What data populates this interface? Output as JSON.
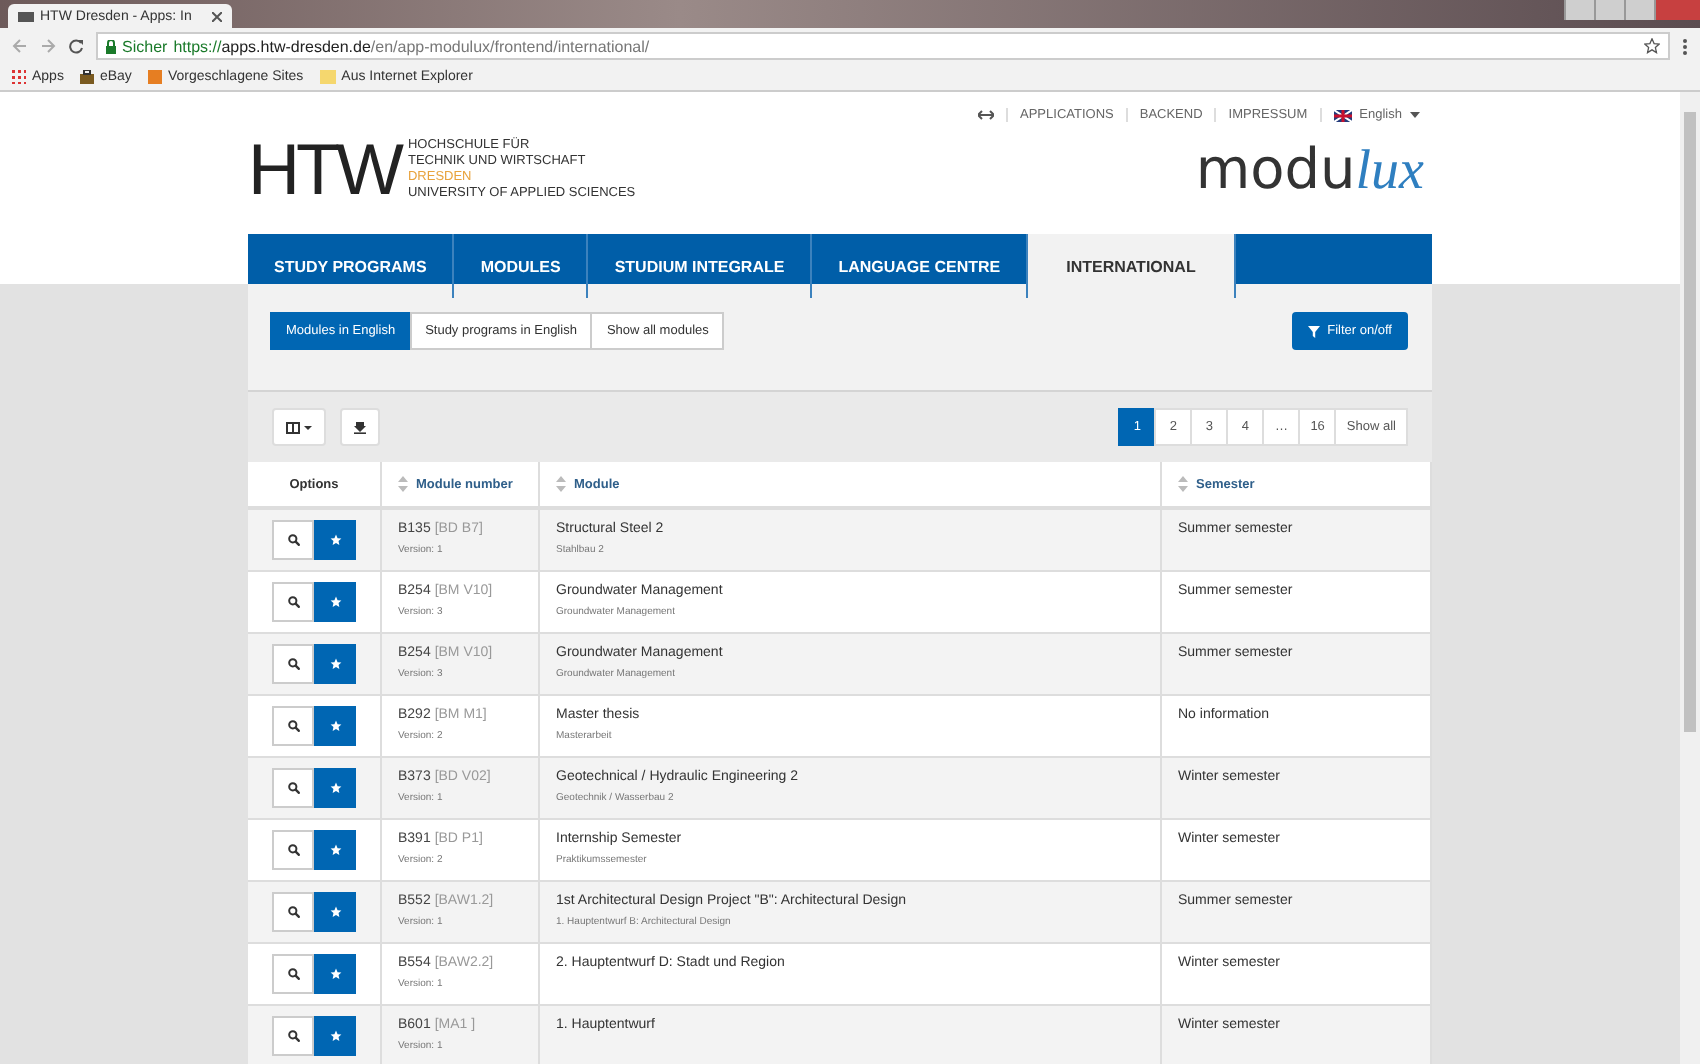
{
  "browser": {
    "tab_title": "HTW Dresden - Apps: In",
    "secure_label": "Sicher",
    "url_scheme": "https://",
    "url_domain": "apps.htw-dresden.de",
    "url_path": "/en/app-modulux/frontend/international/",
    "bookmarks": [
      "Apps",
      "eBay",
      "Vorgeschlagene Sites",
      "Aus Internet Explorer"
    ]
  },
  "top_links": [
    "APPLICATIONS",
    "BACKEND",
    "IMPRESSUM"
  ],
  "language": "English",
  "logo": {
    "mark": "HTW",
    "lines": [
      "HOCHSCHULE FÜR",
      "TECHNIK UND WIRTSCHAFT",
      "DRESDEN",
      "UNIVERSITY OF APPLIED SCIENCES"
    ],
    "app_name": "modu",
    "app_name_script": "lux"
  },
  "nav": [
    {
      "label": "STUDY PROGRAMS",
      "selected": false
    },
    {
      "label": "MODULES",
      "selected": false
    },
    {
      "label": "STUDIUM INTEGRALE",
      "selected": false
    },
    {
      "label": "LANGUAGE CENTRE",
      "selected": false
    },
    {
      "label": "INTERNATIONAL",
      "selected": true
    }
  ],
  "filters": [
    {
      "label": "Modules in English",
      "selected": true
    },
    {
      "label": "Study programs in English",
      "selected": false
    },
    {
      "label": "Show all modules",
      "selected": false
    }
  ],
  "filter_button": "Filter on/off",
  "pagination": [
    {
      "label": "1",
      "selected": true
    },
    {
      "label": "2",
      "selected": false
    },
    {
      "label": "3",
      "selected": false
    },
    {
      "label": "4",
      "selected": false
    },
    {
      "label": "…",
      "selected": false
    },
    {
      "label": "16",
      "selected": false
    },
    {
      "label": "Show all",
      "selected": false
    }
  ],
  "table": {
    "columns": [
      "Options",
      "Module number",
      "Module",
      "Semester"
    ],
    "rows": [
      {
        "number": "B135",
        "code": "[BD B7]",
        "version": "Version: 1",
        "module": "Structural Steel 2",
        "subtitle": "Stahlbau 2",
        "semester": "Summer semester"
      },
      {
        "number": "B254",
        "code": "[BM V10]",
        "version": "Version: 3",
        "module": "Groundwater Management",
        "subtitle": "Groundwater Management",
        "semester": "Summer semester"
      },
      {
        "number": "B254",
        "code": "[BM V10]",
        "version": "Version: 3",
        "module": "Groundwater Management",
        "subtitle": "Groundwater Management",
        "semester": "Summer semester"
      },
      {
        "number": "B292",
        "code": "[BM M1]",
        "version": "Version: 2",
        "module": "Master thesis",
        "subtitle": "Masterarbeit",
        "semester": "No information"
      },
      {
        "number": "B373",
        "code": "[BD V02]",
        "version": "Version: 1",
        "module": "Geotechnical / Hydraulic Engineering 2",
        "subtitle": "Geotechnik / Wasserbau 2",
        "semester": "Winter semester"
      },
      {
        "number": "B391",
        "code": "[BD P1]",
        "version": "Version: 2",
        "module": "Internship Semester",
        "subtitle": "Praktikumssemester",
        "semester": "Winter semester"
      },
      {
        "number": "B552",
        "code": "[BAW1.2]",
        "version": "Version: 1",
        "module": "1st Architectural Design Project \"B\": Architectural Design",
        "subtitle": "1. Hauptentwurf B: Architectural Design",
        "semester": "Summer semester"
      },
      {
        "number": "B554",
        "code": "[BAW2.2]",
        "version": "Version: 1",
        "module": "2. Hauptentwurf D: Stadt und Region",
        "semester": "Winter semester"
      },
      {
        "number": "B601",
        "code": "[MA1 ]",
        "version": "Version: 1",
        "module": "1. Hauptentwurf",
        "semester": "Winter semester"
      }
    ]
  }
}
